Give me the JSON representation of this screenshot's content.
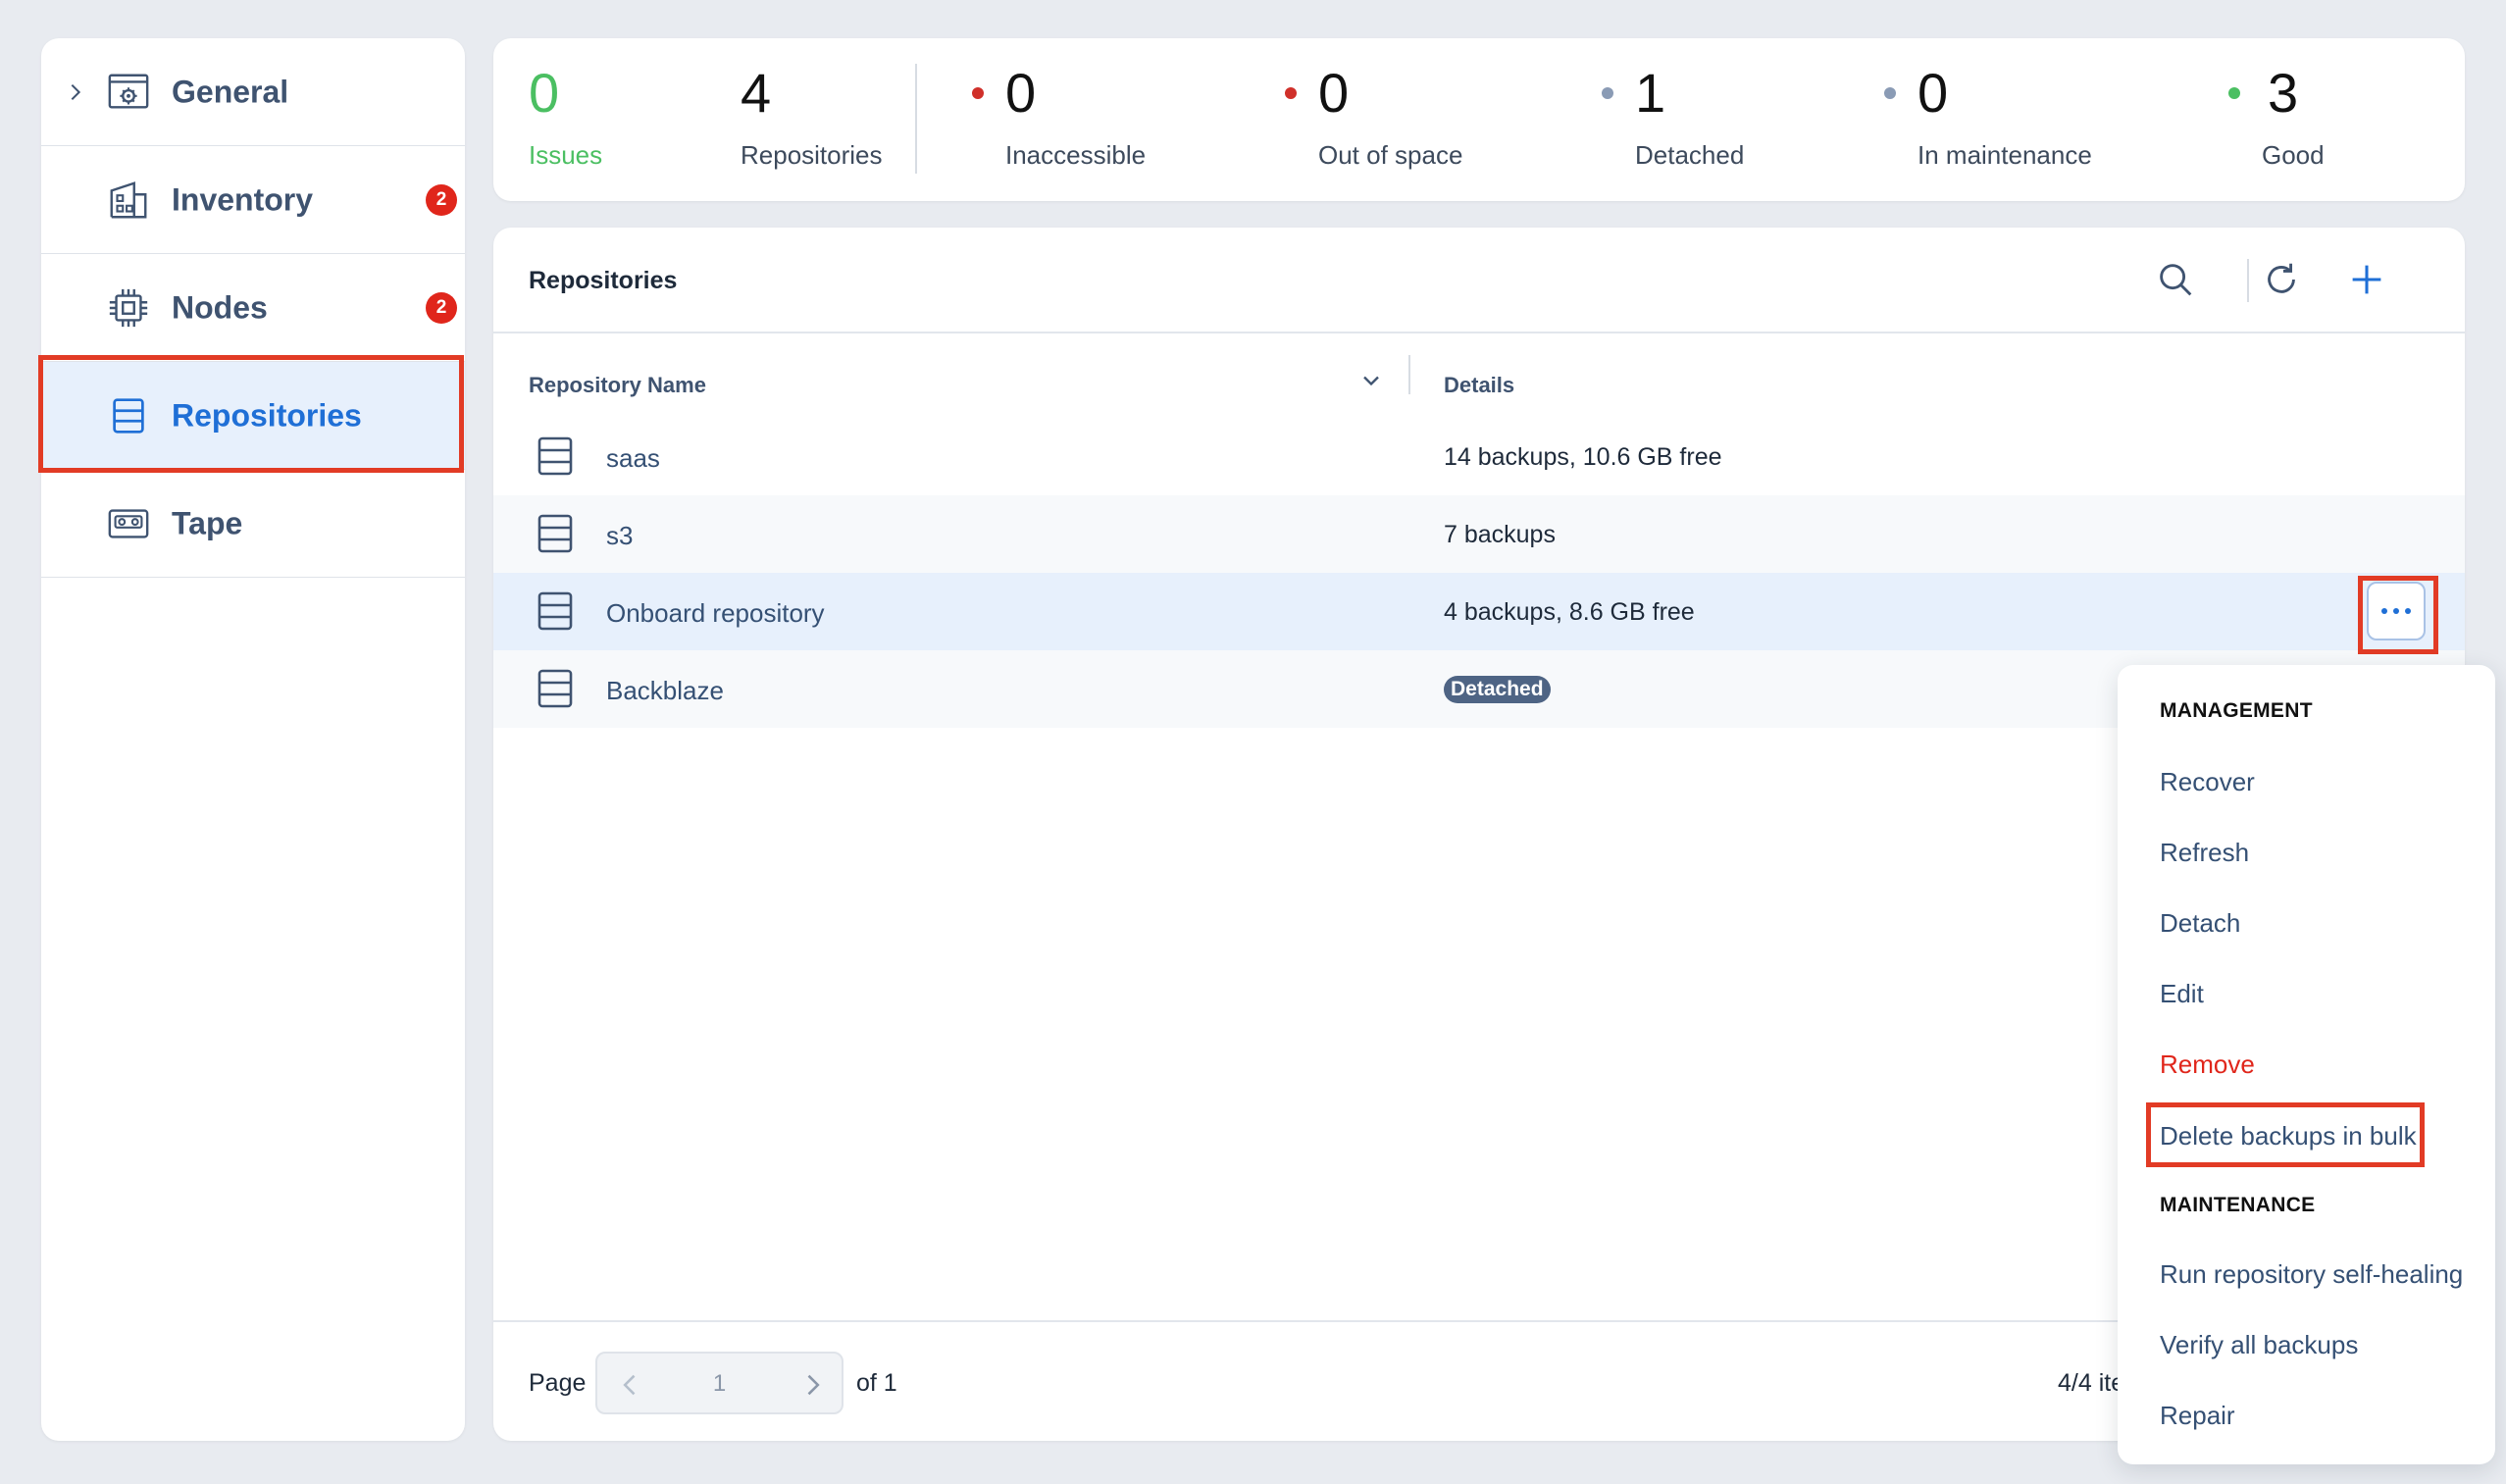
{
  "sidebar": {
    "items": [
      {
        "label": "General"
      },
      {
        "label": "Inventory",
        "badge": "2"
      },
      {
        "label": "Nodes",
        "badge": "2"
      },
      {
        "label": "Repositories"
      },
      {
        "label": "Tape"
      }
    ],
    "active_item": "Repositories"
  },
  "stats": {
    "issues": {
      "value": "0",
      "label": "Issues",
      "color": "#4bbf62"
    },
    "repositories": {
      "value": "4",
      "label": "Repositories"
    },
    "inaccessible": {
      "value": "0",
      "label": "Inaccessible",
      "dot_color": "#d0302a"
    },
    "out_of_space": {
      "value": "0",
      "label": "Out of space",
      "dot_color": "#d0302a"
    },
    "detached": {
      "value": "1",
      "label": "Detached",
      "dot_color": "#8a9bb5"
    },
    "in_maintenance": {
      "value": "0",
      "label": "In maintenance",
      "dot_color": "#8a9bb5"
    },
    "good": {
      "value": "3",
      "label": "Good",
      "dot_color": "#4bbf62"
    }
  },
  "panel": {
    "title": "Repositories",
    "icons": [
      "search-icon",
      "refresh-icon",
      "plus-icon"
    ],
    "columns": {
      "name": "Repository Name",
      "details": "Details"
    },
    "rows": [
      {
        "name": "saas",
        "details": "14 backups, 10.6 GB free"
      },
      {
        "name": "s3",
        "details": "7 backups"
      },
      {
        "name": "Onboard repository",
        "details": "4 backups, 8.6 GB free",
        "selected": true
      },
      {
        "name": "Backblaze",
        "badge": "Detached"
      }
    ]
  },
  "pagination": {
    "page_label": "Page",
    "current_page": "1",
    "of_label": "of 1",
    "items_label": "4/4 ite"
  },
  "context_menu": {
    "section_management": "MANAGEMENT",
    "management_items": [
      "Recover",
      "Refresh",
      "Detach",
      "Edit",
      "Remove",
      "Delete backups in bulk"
    ],
    "section_maintenance": "MAINTENANCE",
    "maintenance_items": [
      "Run repository self-healing",
      "Verify all backups",
      "Repair"
    ]
  },
  "colors": {
    "accent": "#1f6fd6",
    "highlight_box": "#e23b25",
    "danger": "#e0261b",
    "link": "#355074"
  }
}
